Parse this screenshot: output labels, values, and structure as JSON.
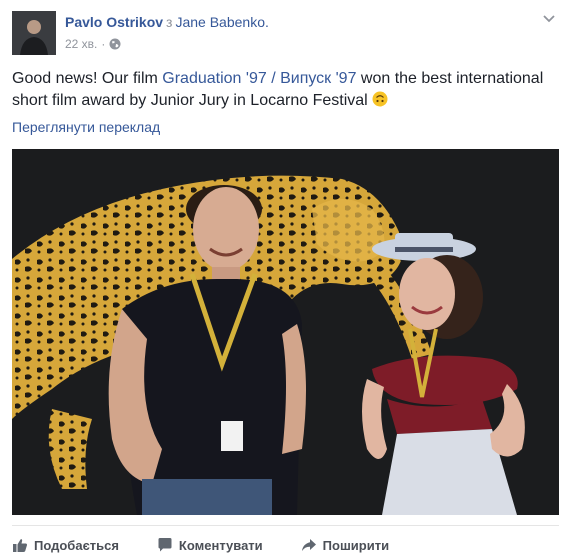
{
  "post": {
    "author": "Pavlo Ostrikov",
    "with_word": "з",
    "tagged_user": "Jane Babenko.",
    "time": "22 хв.",
    "separator": "·",
    "privacy_icon": "globe-icon",
    "menu_icon": "chevron-down-icon",
    "text_before": "Good news! Our film ",
    "film_link": "Graduation '97 / Випуск '97",
    "text_after": " won the best international short film award by Junior Jury in Locarno Festival",
    "emoji_icon": "upside-down-smile-emoji",
    "translate_link": "Переглянути переклад"
  },
  "actions": {
    "like_label": "Подобається",
    "comment_label": "Коментувати",
    "share_label": "Поширити",
    "like_icon": "thumbs-up-icon",
    "comment_icon": "comment-icon",
    "share_icon": "share-arrow-icon"
  },
  "colors": {
    "link": "#365899",
    "meta": "#90949c",
    "text": "#1d2129",
    "action": "#4b4f56"
  }
}
